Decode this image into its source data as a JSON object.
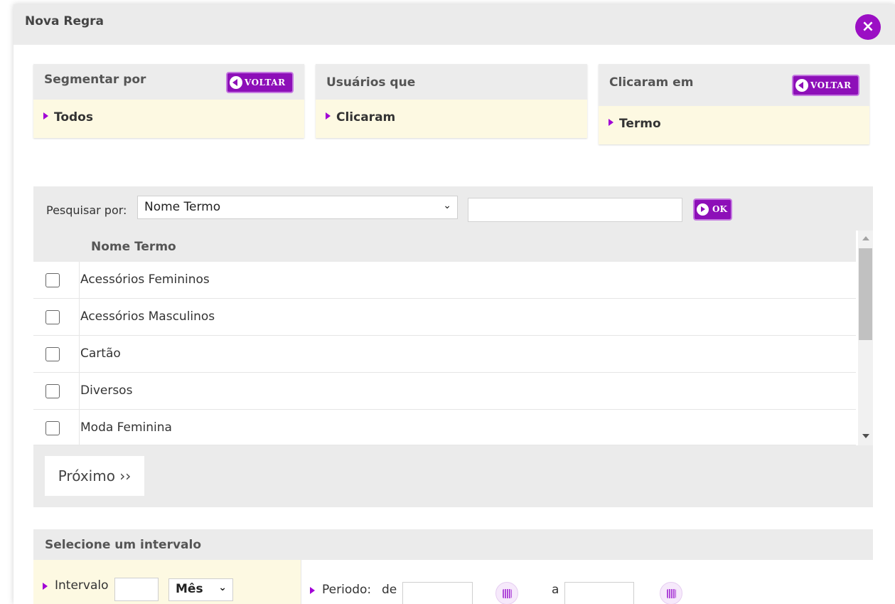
{
  "modal": {
    "title": "Nova Regra",
    "close_icon": "close-icon"
  },
  "steps": [
    {
      "title": "Segmentar por",
      "value": "Todos",
      "button": "VOLTAR"
    },
    {
      "title": "Usuários que",
      "value": "Clicaram"
    },
    {
      "title": "Clicaram em",
      "value": "Termo",
      "button": "VOLTAR"
    }
  ],
  "search": {
    "label": "Pesquisar por:",
    "selected_option": "Nome Termo",
    "input_value": "",
    "ok_label": "OK"
  },
  "table": {
    "column": "Nome Termo",
    "rows": [
      {
        "label": "Acessórios Femininos",
        "checked": false
      },
      {
        "label": "Acessórios Masculinos",
        "checked": false
      },
      {
        "label": "Cartão",
        "checked": false
      },
      {
        "label": "Diversos",
        "checked": false
      },
      {
        "label": "Moda Feminina",
        "checked": false
      }
    ]
  },
  "next_button": "Próximo ››",
  "interval": {
    "title": "Selecione um intervalo",
    "interval_label": "Intervalo",
    "interval_value": "",
    "unit_selected": "Mês",
    "period_label": "Periodo:",
    "from_label": "de",
    "to_label": "a",
    "from_value": "",
    "to_value": ""
  },
  "colors": {
    "accent": "#8d0fb8",
    "highlight_bg": "#fdf9e2",
    "panel_bg": "#ebebeb"
  }
}
